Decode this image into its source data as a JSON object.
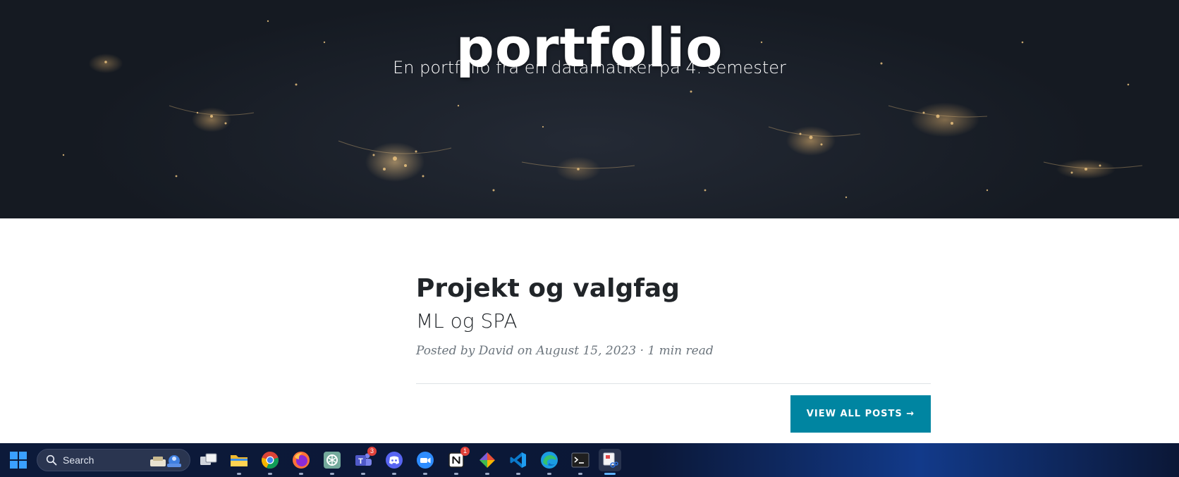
{
  "hero": {
    "title": "portfolio",
    "subtitle": "En portfolio fra en datamatiker på 4. semester"
  },
  "post": {
    "title": "Projekt og valgfag",
    "subtitle": "ML og SPA",
    "meta_prefix": "Posted by ",
    "author": "David",
    "meta_suffix": " on August 15, 2023 · 1 min read"
  },
  "pager": {
    "view_all_label": "VIEW ALL POSTS →",
    "button_color": "#0085a1"
  },
  "taskbar": {
    "search_label": "Search",
    "apps": [
      {
        "name": "task-view-icon"
      },
      {
        "name": "file-explorer-icon"
      },
      {
        "name": "chrome-icon"
      },
      {
        "name": "firefox-icon"
      },
      {
        "name": "chatgpt-icon"
      },
      {
        "name": "teams-icon",
        "badge": "3"
      },
      {
        "name": "discord-icon"
      },
      {
        "name": "zoom-icon"
      },
      {
        "name": "notion-icon",
        "badge": "1"
      },
      {
        "name": "git-client-icon"
      },
      {
        "name": "vscode-icon"
      },
      {
        "name": "edge-icon"
      },
      {
        "name": "terminal-icon"
      },
      {
        "name": "snipping-tool-icon",
        "active": true
      }
    ]
  }
}
